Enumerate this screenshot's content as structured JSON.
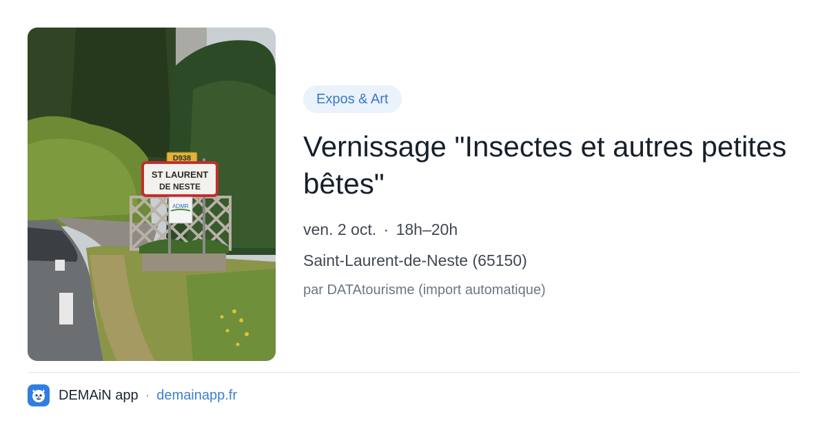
{
  "event": {
    "category": "Expos & Art",
    "title": "Vernissage \"Insectes et autres petites bêtes\"",
    "date": "ven. 2 oct.",
    "time": "18h–20h",
    "location": "Saint-Laurent-de-Neste (65150)",
    "source": "par DATAtourisme (import automatique)"
  },
  "photo": {
    "road_marker": "D938",
    "sign_line1": "ST LAURENT",
    "sign_line2": "DE NESTE",
    "panel_text": "ADMR"
  },
  "footer": {
    "app_name": "DEMAiN app",
    "separator": "·",
    "domain": "demainapp.fr",
    "logo_icon": "lion-mascot-icon"
  },
  "colors": {
    "chip_bg": "#eaf2fc",
    "chip_text": "#3a78c9",
    "link": "#3a7fd0",
    "logo_bg": "#2f7fe2"
  }
}
